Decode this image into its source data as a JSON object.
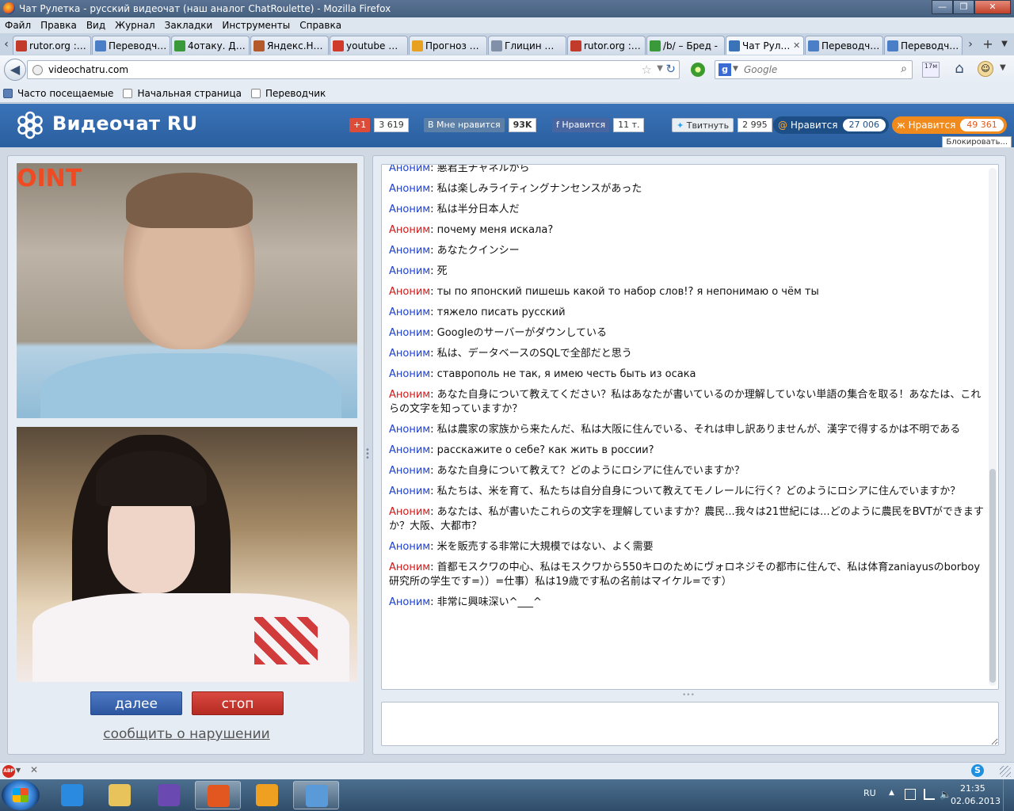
{
  "window": {
    "title": "Чат Рулетка - русский видеочат (наш аналог ChatRoulette) - Mozilla Firefox",
    "buttons": [
      "—",
      "❒",
      "✕"
    ]
  },
  "menu": [
    "Файл",
    "Правка",
    "Вид",
    "Журнал",
    "Закладки",
    "Инструменты",
    "Справка"
  ],
  "tabs": [
    {
      "label": "rutor.org :: ...",
      "icon": "rutor-icon",
      "color": "#c23a2a"
    },
    {
      "label": "Переводчи...",
      "icon": "translate-icon",
      "color": "#4a7fc8"
    },
    {
      "label": "4отаку. Дис...",
      "icon": "4otaku-icon",
      "color": "#3a9a3a"
    },
    {
      "label": "Яндекс.Нар...",
      "icon": "yandex-narod-icon",
      "color": "#b45a2a"
    },
    {
      "label": "youtube — ...",
      "icon": "yandex-icon",
      "color": "#d03a2a"
    },
    {
      "label": "Прогноз по...",
      "icon": "weather-icon",
      "color": "#e8a020"
    },
    {
      "label": "Глицин — ...",
      "icon": "page-icon",
      "color": "#8090a8"
    },
    {
      "label": "rutor.org :: ...",
      "icon": "rutor-icon",
      "color": "#c23a2a"
    },
    {
      "label": "/b/ – Бред -",
      "icon": "loading-icon",
      "color": "#3a9a3a"
    },
    {
      "label": "Чат Руле...",
      "icon": "videochat-icon",
      "color": "#3a73b8",
      "active": true
    },
    {
      "label": "Переводчи...",
      "icon": "translate-icon",
      "color": "#4a7fc8"
    },
    {
      "label": "Переводчи...",
      "icon": "translate-icon",
      "color": "#4a7fc8"
    }
  ],
  "tab_close_glyph": "✕",
  "tab_new_glyph": "+",
  "tab_scroll_left": "‹",
  "tab_scroll_right": "›",
  "nav": {
    "url": "videochatru.com",
    "search_placeholder": "Google",
    "search_engine_letter": "g",
    "addon_label": "17м"
  },
  "bookmarks": [
    "Часто посещаемые",
    "Начальная страница",
    "Переводчик"
  ],
  "site": {
    "logo_text": "Видеочат RU",
    "social": {
      "gplus_label": "+1",
      "gplus_count": "3 619",
      "vk_label": "Мне нравится",
      "vk_count": "93K",
      "fb_label": "Нравится",
      "fb_count": "11 т.",
      "tw_label": "Твитнуть",
      "tw_count": "2 995",
      "mailru_label": "Нравится",
      "mailru_count": "27 006",
      "ok_label": "Нравится",
      "ok_count": "49 361"
    },
    "block_label": "Блокировать..."
  },
  "video": {
    "top_sign": "OINT"
  },
  "controls": {
    "next_label": "далее",
    "stop_label": "стоп",
    "report_label": "сообщить о нарушении"
  },
  "chat": {
    "messages": [
      {
        "author": "Аноним",
        "text": "悪君主チャネルから",
        "color": "blue"
      },
      {
        "author": "Аноним",
        "text": "私は楽しみライティングナンセンスがあった",
        "color": "blue"
      },
      {
        "author": "Аноним",
        "text": "私は半分日本人だ",
        "color": "blue"
      },
      {
        "author": "Аноним",
        "text": "почему меня искала?",
        "color": "red"
      },
      {
        "author": "Аноним",
        "text": "あなたクインシー",
        "color": "blue"
      },
      {
        "author": "Аноним",
        "text": "死",
        "color": "blue"
      },
      {
        "author": "Аноним",
        "text": "ты по японский пишешь какой то набор слов!? я непонимаю о чём ты",
        "color": "red"
      },
      {
        "author": "Аноним",
        "text": "тяжело писать русский",
        "color": "blue"
      },
      {
        "author": "Аноним",
        "text": "Googleのサーバーがダウンしている",
        "color": "blue"
      },
      {
        "author": "Аноним",
        "text": "私は、データベースのSQLで全部だと思う",
        "color": "blue"
      },
      {
        "author": "Аноним",
        "text": "ставрополь не так, я имею честь быть из осака",
        "color": "blue"
      },
      {
        "author": "Аноним",
        "text": "あなた自身について教えてください？私はあなたが書いているのか理解していない単語の集合を取る！あなたは、これらの文字を知っていますか？",
        "color": "red"
      },
      {
        "author": "Аноним",
        "text": "私は農家の家族から来たんだ、私は大阪に住んでいる、それは申し訳ありませんが、漢字で得するかは不明である",
        "color": "blue"
      },
      {
        "author": "Аноним",
        "text": "расскажите о себе? как жить в россии?",
        "color": "blue"
      },
      {
        "author": "Аноним",
        "text": "あなた自身について教えて？どのようにロシアに住んでいますか？",
        "color": "blue"
      },
      {
        "author": "Аноним",
        "text": "私たちは、米を育て、私たちは自分自身について教えてモノレールに行く？どのようにロシアに住んでいますか？",
        "color": "blue"
      },
      {
        "author": "Аноним",
        "text": "あなたは、私が書いたこれらの文字を理解していますか？農民...我々は21世紀には...どのように農民をBVTができますか？大阪、大都市？",
        "color": "red"
      },
      {
        "author": "Аноним",
        "text": "米を販売する非常に大規模ではない、よく需要",
        "color": "blue"
      },
      {
        "author": "Аноним",
        "text": "首都モスクワの中心、私はモスクワから550キロのためにヴォロネジその都市に住んで、私は体育zaniayusのborboy研究所の学生です=））=仕事）私は19歳です私の名前はマイケル=です）",
        "color": "red"
      },
      {
        "author": "Аноним",
        "text": "非常に興味深い^___^",
        "color": "blue"
      }
    ],
    "grip": "•••",
    "input_value": ""
  },
  "statusbar": {
    "abp_label": "ABP",
    "close_glyph": "✕",
    "skype_letter": "S"
  },
  "taskbar": {
    "apps": [
      {
        "name": "taskbar-ie",
        "state": "pinned",
        "color": "#2a8ae0"
      },
      {
        "name": "taskbar-explorer",
        "state": "pinned",
        "color": "#e8c25a"
      },
      {
        "name": "taskbar-visual-studio",
        "state": "pinned",
        "color": "#6a4ab0"
      },
      {
        "name": "taskbar-firefox",
        "state": "running",
        "color": "#e2561f"
      },
      {
        "name": "taskbar-avast",
        "state": "pinned",
        "color": "#f0a020"
      },
      {
        "name": "taskbar-control-panel",
        "state": "running",
        "color": "#5a9ad8"
      }
    ],
    "lang": "RU",
    "time": "21:35",
    "date": "02.06.2013"
  },
  "colors": {
    "site_header": "#3a73b8",
    "author_blue": "#1d3fcf",
    "author_red": "#d01818",
    "next_button": "#2d56a0",
    "stop_button": "#b52a22"
  }
}
